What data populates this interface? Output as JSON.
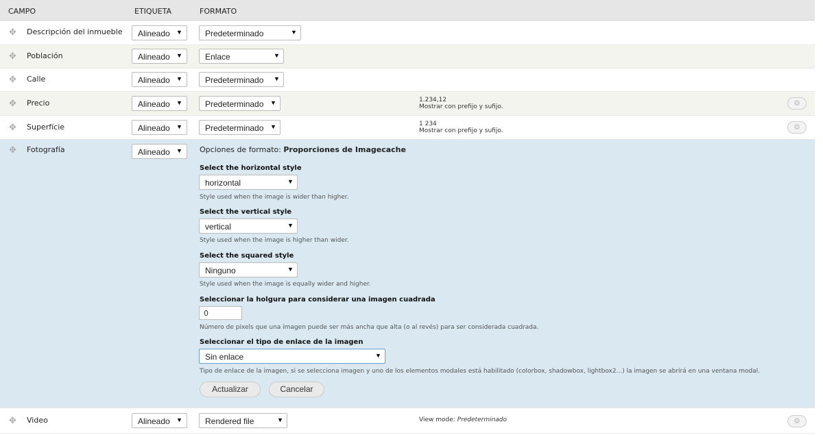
{
  "headers": {
    "campo": "CAMPO",
    "etiqueta": "ETIQUETA",
    "formato": "FORMATO"
  },
  "rows": [
    {
      "field": "Descripción del inmueble",
      "label": "Alineado",
      "format": "Predeterminado"
    },
    {
      "field": "Población",
      "label": "Alineado",
      "format": "Enlace"
    },
    {
      "field": "Calle",
      "label": "Alineado",
      "format": "Predeterminado"
    },
    {
      "field": "Precio",
      "label": "Alineado",
      "format": "Predeterminado",
      "summary1": "1.234,12",
      "summary2": "Mostrar con prefijo y sufijo."
    },
    {
      "field": "Superfície",
      "label": "Alineado",
      "format": "Predeterminado",
      "summary1": "1 234",
      "summary2": "Mostrar con prefijo y sufijo."
    },
    {
      "field": "Fotografía",
      "label": "Alineado"
    },
    {
      "field": "Video",
      "label": "Alineado",
      "format": "Rendered file",
      "summary_prefix": "View mode: ",
      "summary_italic": "Predeterminado"
    }
  ],
  "settings": {
    "title_prefix": "Opciones de formato: ",
    "title_bold": "Proporciones de Imagecache",
    "horizontal_label": "Select the horizontal style",
    "horizontal_value": "horizontal",
    "horizontal_desc": "Style used when the image is wider than higher.",
    "vertical_label": "Select the vertical style",
    "vertical_value": "vertical",
    "vertical_desc": "Style used when the image is higher than wider.",
    "squared_label": "Select the squared style",
    "squared_value": "Ninguno",
    "squared_desc": "Style used when the image is equally wider and higher.",
    "holgura_label": "Seleccionar la holgura para considerar una imagen cuadrada",
    "holgura_value": "0",
    "holgura_desc": "Número de pixels que una imagen puede ser más ancha que alta (o al revés) para ser considerada cuadrada.",
    "link_label": "Seleccionar el tipo de enlace de la imagen",
    "link_value": "Sin enlace",
    "link_desc": "Tipo de enlace de la imagen, si se selecciona imagen y uno de los elementos modales está habilitado (colorbox, shadowbox, lightbox2...) la imagen se abrirá en una ventana modal.",
    "update_button": "Actualizar",
    "cancel_button": "Cancelar"
  }
}
